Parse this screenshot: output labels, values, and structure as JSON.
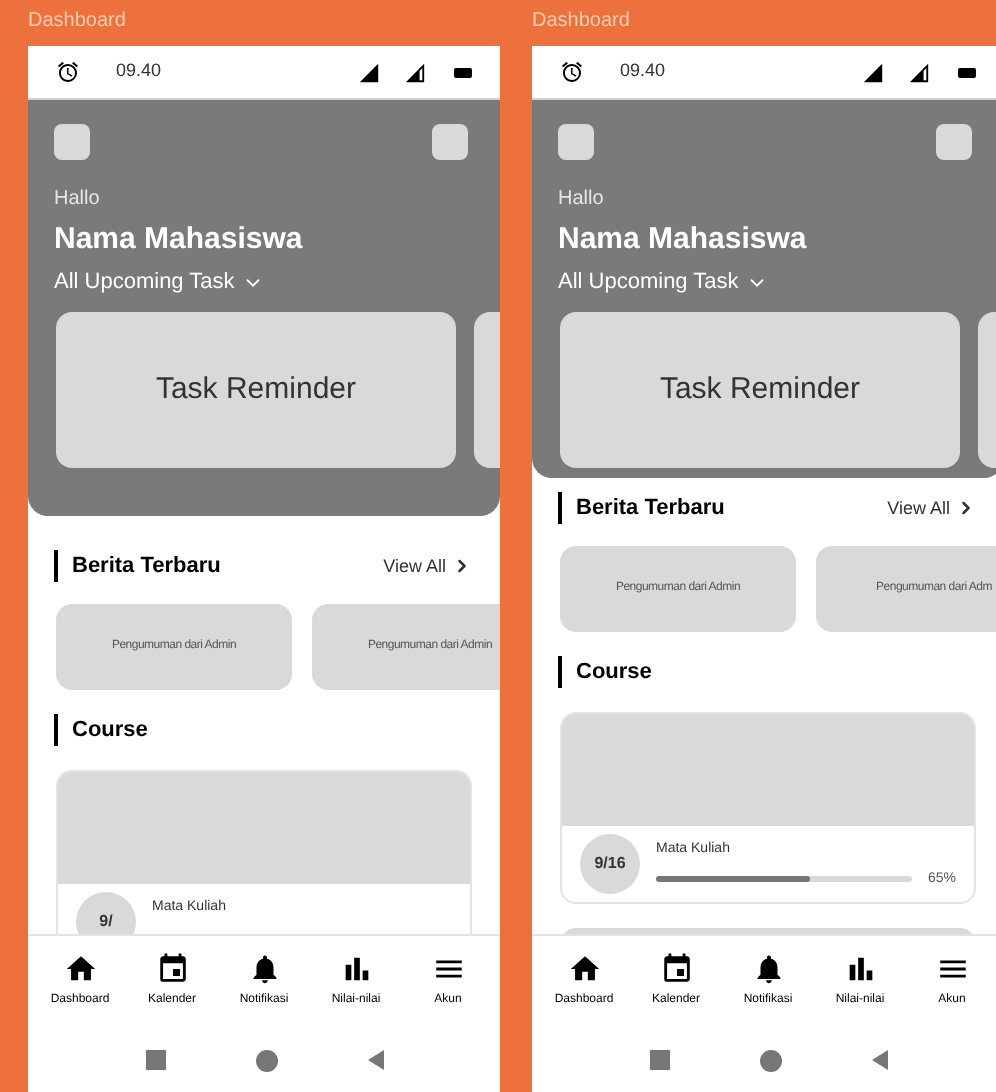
{
  "frames": [
    {
      "label": "Dashboard",
      "time": "09.40",
      "greeting": "Hallo",
      "name": "Nama Mahasiswa",
      "filter": "All Upcoming Task",
      "task_cards": [
        "Task Reminder"
      ],
      "news_title": "Berita Terbaru",
      "view_all": "View All",
      "news_cards": [
        "Pengumuman dari Admin",
        "Pengumuman dari Admin"
      ],
      "course_title": "Course",
      "courses": [
        {
          "title": "Mata Kuliah",
          "count": "9/"
        }
      ],
      "nav": [
        "Dashboard",
        "Kalender",
        "Notifikasi",
        "Nilai-nilai",
        "Akun"
      ]
    },
    {
      "label": "Dashboard",
      "time": "09.40",
      "greeting": "Hallo",
      "name": "Nama Mahasiswa",
      "filter": "All Upcoming Task",
      "task_cards": [
        "Task Reminder"
      ],
      "news_title": "Berita Terbaru",
      "view_all": "View All",
      "news_cards": [
        "Pengumuman dari Admin",
        "Pengumuman dari Adm"
      ],
      "course_title": "Course",
      "courses": [
        {
          "title": "Mata Kuliah",
          "count": "9/16",
          "level": 0.6,
          "reading": "65%"
        }
      ],
      "nav": [
        "Dashboard",
        "Kalender",
        "Notifikasi",
        "Nilai-nilai",
        "Akun"
      ]
    }
  ]
}
